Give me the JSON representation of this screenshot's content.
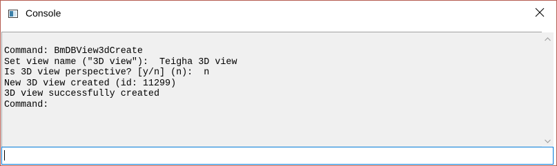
{
  "window": {
    "title": "Console",
    "icons": {
      "app": "console-window-icon",
      "close": "close-icon"
    },
    "colors": {
      "border": "#b45a4f",
      "output_background": "#f0f0f0",
      "input_focus_border": "#0078d7"
    }
  },
  "output": {
    "lines": [
      "Command: BmDBView3dCreate",
      "Set view name (\"3D view\"):  Teigha 3D view",
      "Is 3D view perspective? [y/n] (n):  n",
      "New 3D view created (id: 11299)",
      "3D view successfully created",
      "Command:"
    ]
  },
  "scrollbar": {
    "up_icon": "scroll-up-arrow-icon",
    "down_icon": "scroll-down-arrow-icon"
  },
  "input": {
    "value": "",
    "placeholder": ""
  }
}
